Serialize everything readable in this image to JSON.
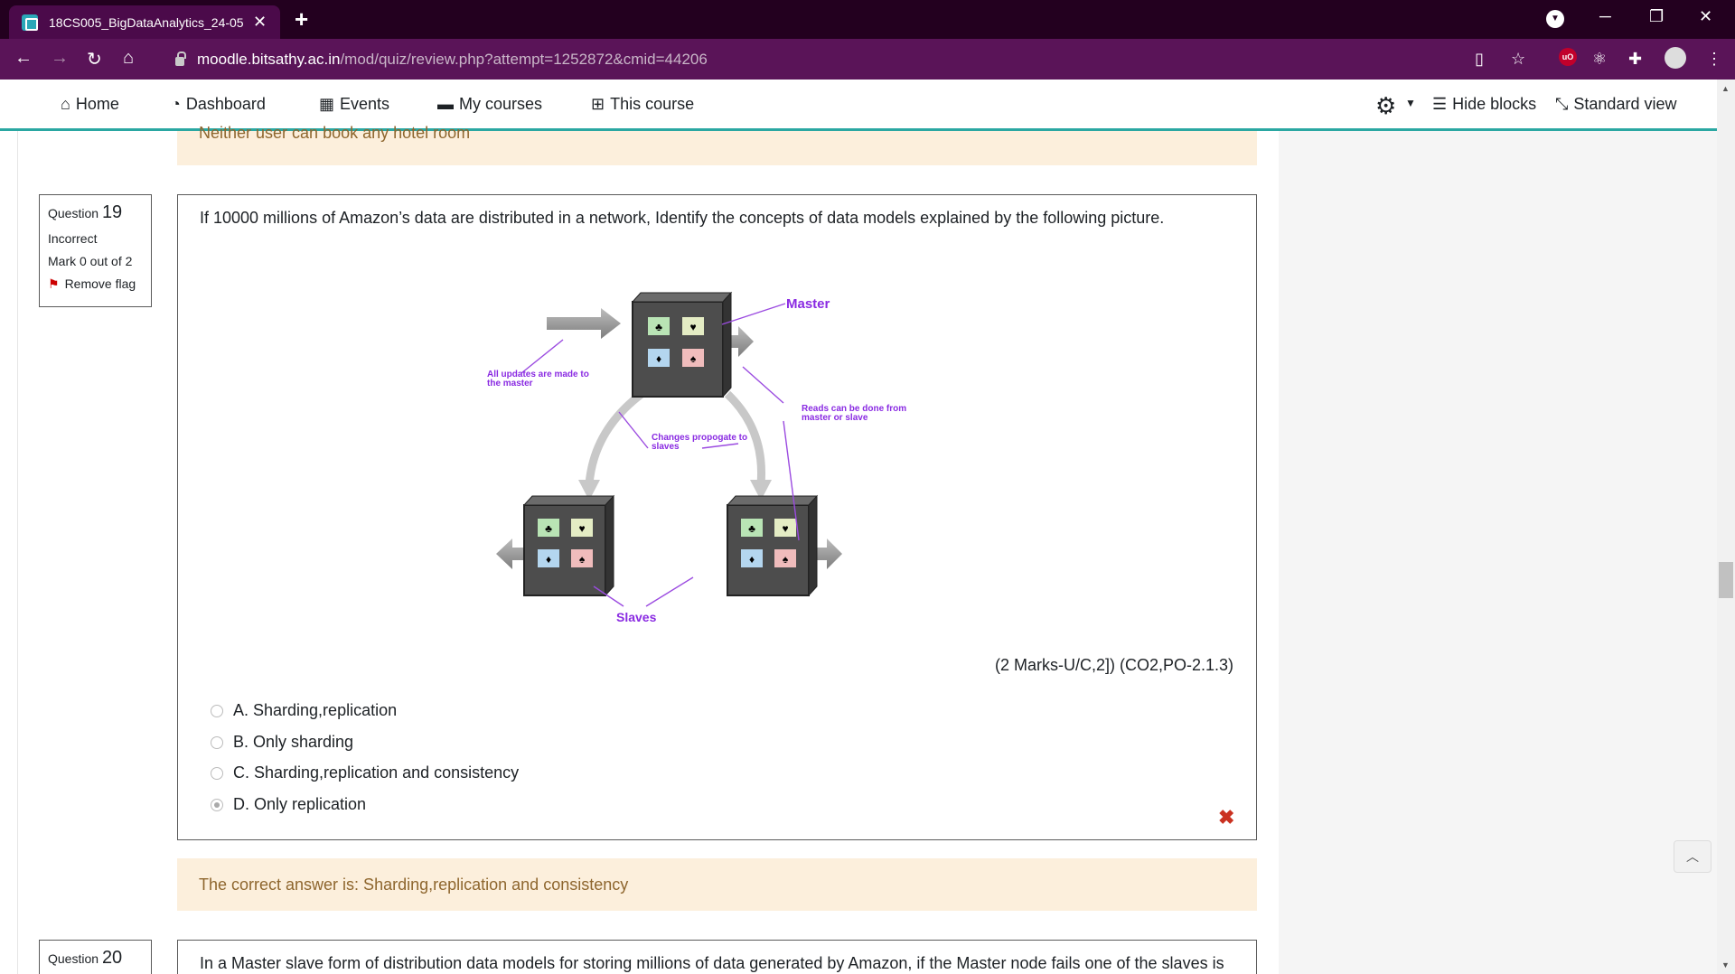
{
  "browser": {
    "tab_title": "18CS005_BigDataAnalytics_24-05",
    "tab_close": "✕",
    "new_tab": "+",
    "url_host": "moodle.bitsathy.ac.in",
    "url_path": "/mod/quiz/review.php?attempt=1252872&cmid=44206",
    "ublock_label": "uO"
  },
  "navbar": {
    "items": [
      {
        "label": "Home",
        "icon": "home-icon"
      },
      {
        "label": "Dashboard",
        "icon": "dashboard-icon"
      },
      {
        "label": "Events",
        "icon": "calendar-icon"
      },
      {
        "label": "My courses",
        "icon": "briefcase-icon"
      },
      {
        "label": "This course",
        "icon": "sitemap-icon"
      }
    ],
    "hide_blocks": "Hide blocks",
    "standard_view": "Standard view"
  },
  "previous_feedback": "Neither user can book any hotel room",
  "question19": {
    "label": "Question",
    "number": "19",
    "status": "Incorrect",
    "mark": "Mark 0 out of 2",
    "flag": "Remove flag",
    "text": "If 10000 millions of Amazon’s data are distributed in a network, Identify the concepts of data models explained by the following picture.",
    "marks_info": "(2 Marks-U/C,2]) (CO2,PO-2.1.3)",
    "options": [
      {
        "label": "A. Sharding,replication",
        "selected": false
      },
      {
        "label": "B. Only sharding",
        "selected": false
      },
      {
        "label": "C. Sharding,replication and consistency",
        "selected": false
      },
      {
        "label": "D. Only replication",
        "selected": true
      }
    ],
    "correct_answer": "The correct answer is: Sharding,replication and consistency",
    "diagram": {
      "master_label": "Master",
      "updates_label_1": "All updates are made to",
      "updates_label_2": "the master",
      "reads_label_1": "Reads can be done from",
      "reads_label_2": "master or slave",
      "changes_label_1": "Changes propogate to",
      "changes_label_2": "slaves",
      "slaves_label": "Slaves"
    }
  },
  "question20": {
    "label": "Question",
    "number": "20",
    "text": "In a Master slave form of distribution data models for storing millions of data generated by Amazon, if the Master node fails one of the slaves is"
  },
  "colors": {
    "tabbar": "#23001f",
    "toolbar": "#5a1458",
    "accent": "#2aa7a2",
    "feedback_bg": "#fcefdc",
    "diagram_label": "#8a2be2"
  }
}
